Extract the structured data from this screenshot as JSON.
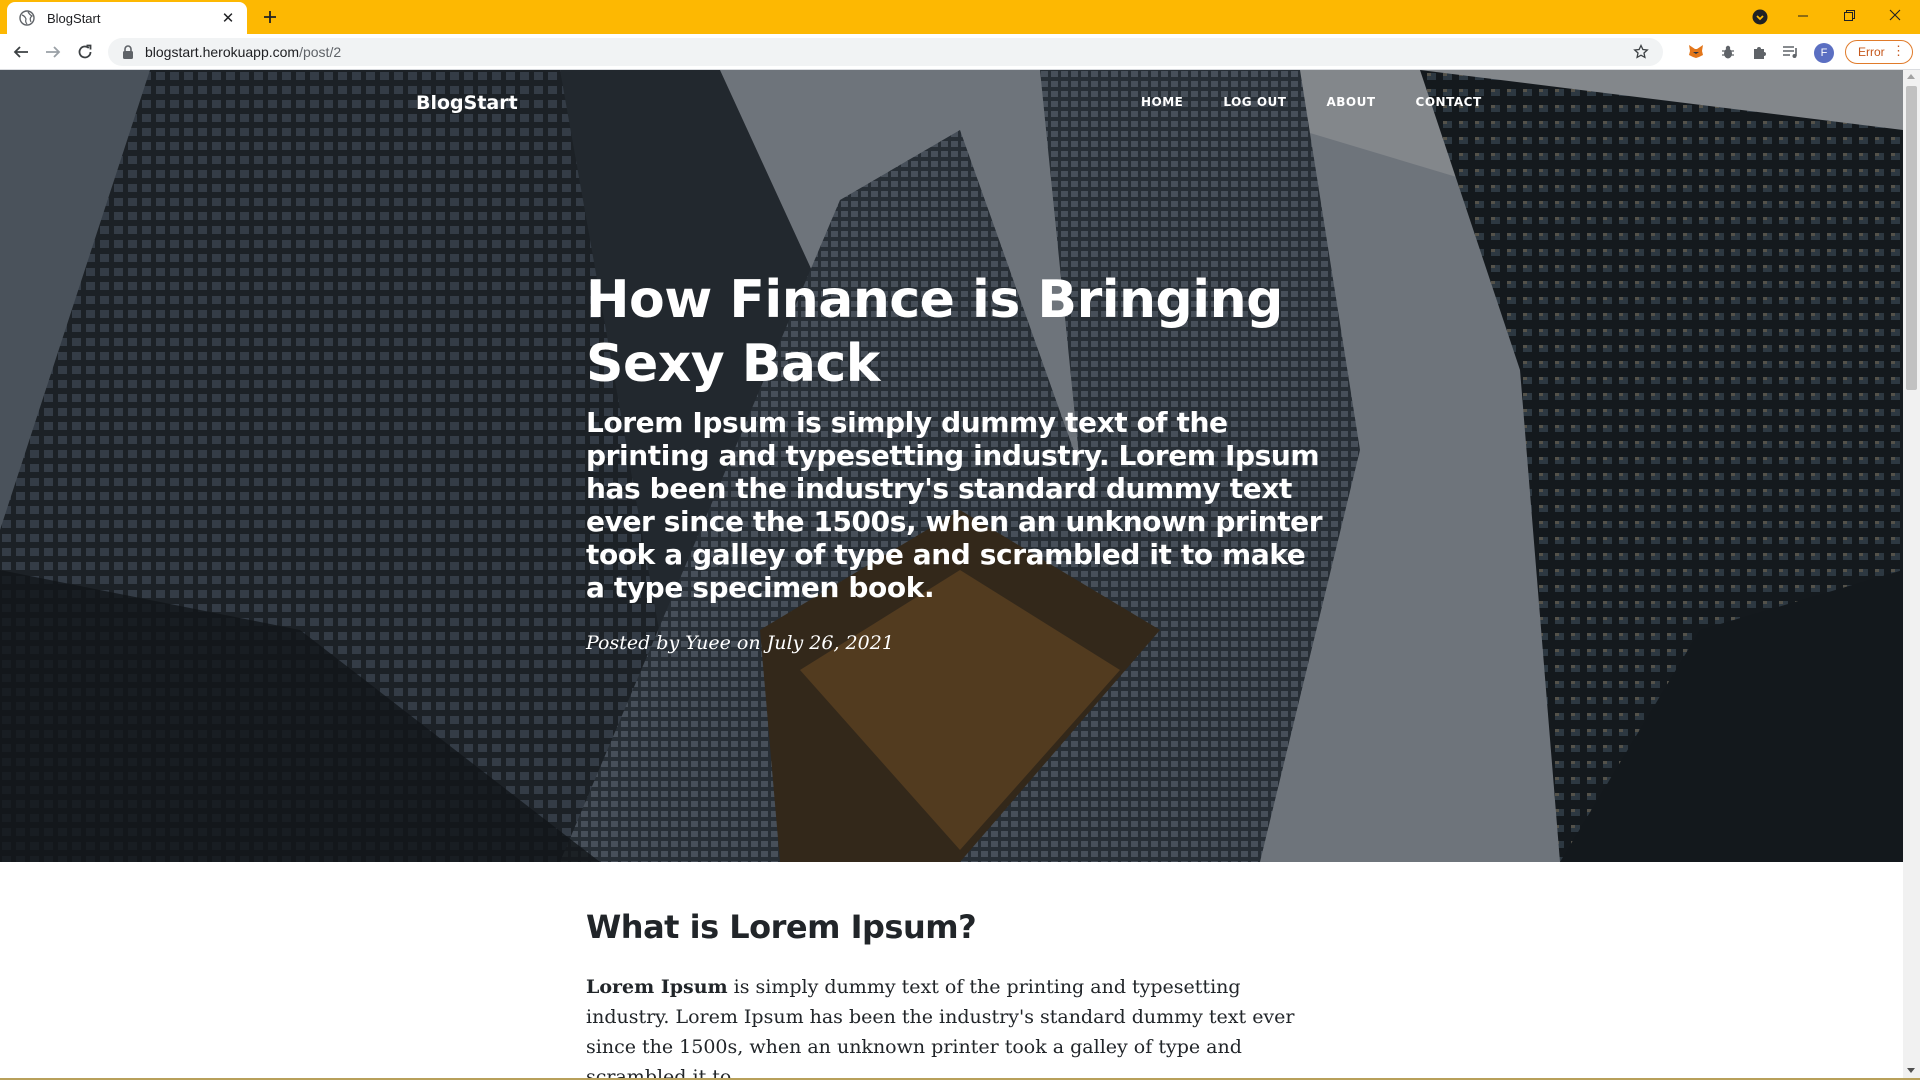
{
  "browser": {
    "tab_title": "BlogStart",
    "url_host": "blogstart.herokuapp.com",
    "url_path": "/post/2",
    "profile_initial": "F",
    "error_label": "Error",
    "accent_color": "#fdb802"
  },
  "site": {
    "brand": "BlogStart",
    "nav": [
      {
        "label": "HOME"
      },
      {
        "label": "LOG OUT"
      },
      {
        "label": "ABOUT"
      },
      {
        "label": "CONTACT"
      }
    ]
  },
  "post": {
    "title": "How Finance is Bringing Sexy Back",
    "subtitle": "Lorem Ipsum is simply dummy text of the printing and typesetting industry. Lorem Ipsum has been the industry's standard dummy text ever since the 1500s, when an unknown printer took a galley of type and scrambled it to make a type specimen book.",
    "meta": "Posted by Yuee on July 26, 2021"
  },
  "content": {
    "heading": "What is Lorem Ipsum?",
    "para_bold": "Lorem Ipsum",
    "para_text": " is simply dummy text of the printing and typesetting industry. Lorem Ipsum has been the industry's standard dummy text ever since the 1500s, when an unknown printer took a galley of type and scrambled it to"
  }
}
